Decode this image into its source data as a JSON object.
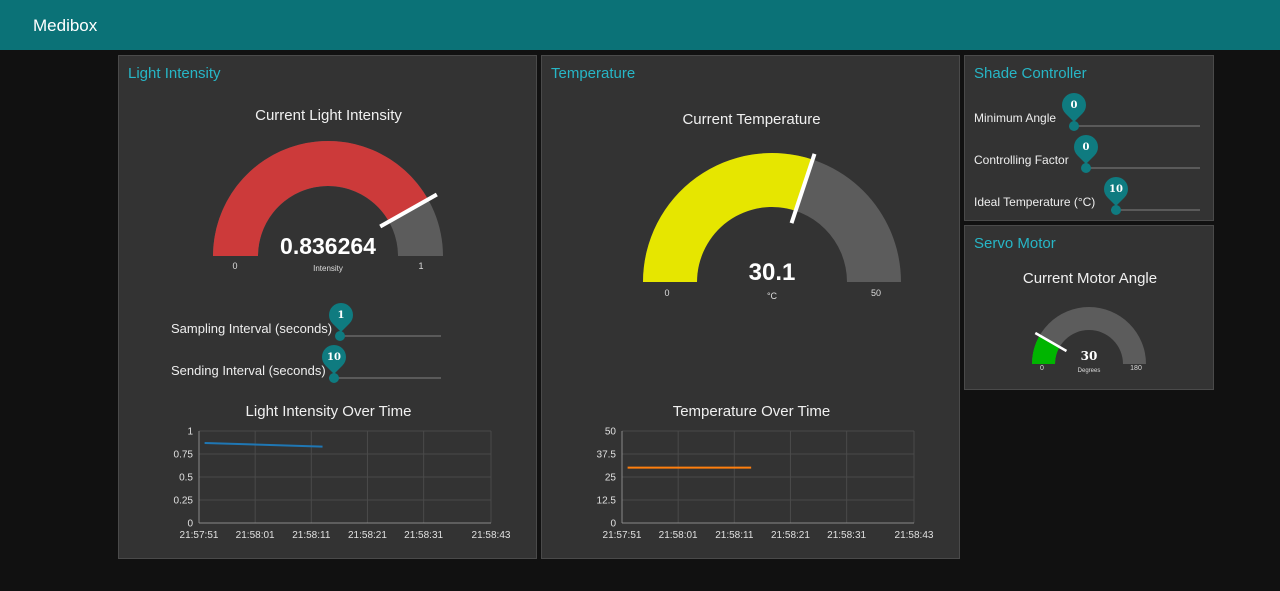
{
  "app": {
    "title": "Medibox"
  },
  "light": {
    "title": "Light Intensity",
    "gauge": {
      "label": "Current Light Intensity",
      "value": "0.836264",
      "value_num": 0.836264,
      "unit": "Intensity",
      "min": "0",
      "max": "1",
      "min_num": 0,
      "max_num": 1,
      "fill_color": "#cc3a3a"
    },
    "sampling": {
      "label": "Sampling Interval (seconds)",
      "value": "1"
    },
    "sending": {
      "label": "Sending Interval (seconds)",
      "value": "10"
    },
    "chart_title": "Light Intensity Over Time"
  },
  "temperature": {
    "title": "Temperature",
    "gauge": {
      "label": "Current Temperature",
      "value": "30.1",
      "value_num": 30.1,
      "unit": "°C",
      "min": "0",
      "max": "50",
      "min_num": 0,
      "max_num": 50,
      "fill_color": "#e6e600"
    },
    "chart_title": "Temperature Over Time"
  },
  "shade": {
    "title": "Shade Controller",
    "min_angle": {
      "label": "Minimum Angle",
      "value": "0"
    },
    "controlling_factor": {
      "label": "Controlling Factor",
      "value": "0"
    },
    "ideal_temp": {
      "label": "Ideal Temperature (°C)",
      "value": "10"
    }
  },
  "servo": {
    "title": "Servo Motor",
    "gauge": {
      "label": "Current Motor Angle",
      "value": "30",
      "value_num": 30,
      "unit": "Degrees",
      "min": "0",
      "max": "180",
      "min_num": 0,
      "max_num": 180,
      "fill_color": "#00b500"
    }
  },
  "colors": {
    "header": "#0b7277",
    "accent": "#27b6c6",
    "track": "#5a5a5a",
    "line_light": "#1f77b4",
    "line_temp": "#ff7f0e"
  },
  "chart_data": [
    {
      "type": "line",
      "title": "Light Intensity Over Time",
      "x_ticks": [
        "21:57:51",
        "21:58:01",
        "21:58:11",
        "21:58:21",
        "21:58:31",
        "21:58:43"
      ],
      "y_ticks": [
        "0",
        "0.25",
        "0.5",
        "0.75",
        "1"
      ],
      "ylim": [
        0,
        1
      ],
      "grid": true,
      "series": [
        {
          "color": "#1f77b4",
          "x": [
            "21:57:52",
            "21:58:13"
          ],
          "y": [
            0.87,
            0.83
          ]
        }
      ]
    },
    {
      "type": "line",
      "title": "Temperature Over Time",
      "x_ticks": [
        "21:57:51",
        "21:58:01",
        "21:58:11",
        "21:58:21",
        "21:58:31",
        "21:58:43"
      ],
      "y_ticks": [
        "0",
        "12.5",
        "25",
        "37.5",
        "50"
      ],
      "ylim": [
        0,
        50
      ],
      "grid": true,
      "series": [
        {
          "color": "#ff7f0e",
          "x": [
            "21:57:52",
            "21:58:14"
          ],
          "y": [
            30.1,
            30.1
          ]
        }
      ]
    }
  ]
}
